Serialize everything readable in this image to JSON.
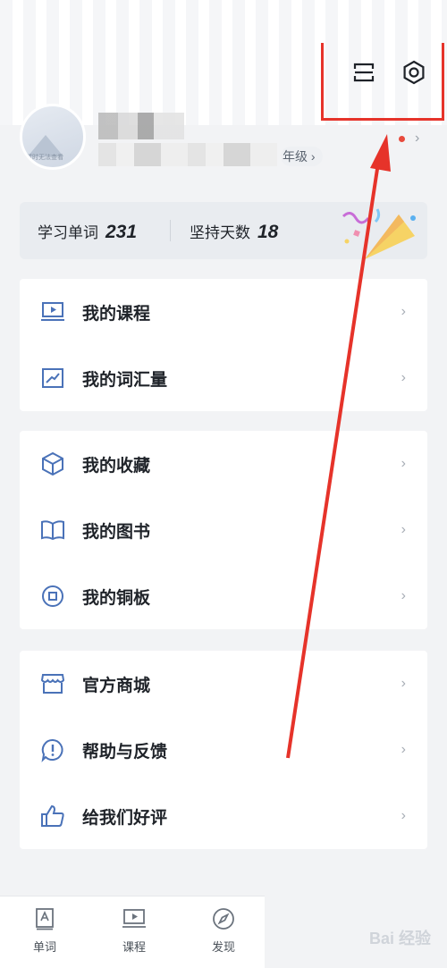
{
  "profile": {
    "avatar_caption": "暂时无法查看",
    "grade_label": "年级",
    "chevron": "›"
  },
  "stats": {
    "words_label": "学习单词",
    "words_value": "231",
    "days_label": "坚持天数",
    "days_value": "18"
  },
  "menu": {
    "group1": [
      {
        "label": "我的课程",
        "icon": "video-screen-icon"
      },
      {
        "label": "我的词汇量",
        "icon": "trend-chart-icon"
      }
    ],
    "group2": [
      {
        "label": "我的收藏",
        "icon": "cube-icon"
      },
      {
        "label": "我的图书",
        "icon": "book-icon"
      },
      {
        "label": "我的铜板",
        "icon": "coin-icon"
      }
    ],
    "group3": [
      {
        "label": "官方商城",
        "icon": "shop-icon"
      },
      {
        "label": "帮助与反馈",
        "icon": "help-bubble-icon"
      },
      {
        "label": "给我们好评",
        "icon": "thumbs-up-icon"
      }
    ],
    "chevron": "›"
  },
  "tabbar": {
    "tabs": [
      {
        "label": "单词",
        "icon": "word-book-icon"
      },
      {
        "label": "课程",
        "icon": "course-screen-icon"
      },
      {
        "label": "发现",
        "icon": "compass-icon"
      }
    ]
  },
  "watermark": "Bai 经验",
  "colors": {
    "accent": "#4a72b8",
    "annotation_red": "#e6332a",
    "background": "#f2f3f5"
  }
}
